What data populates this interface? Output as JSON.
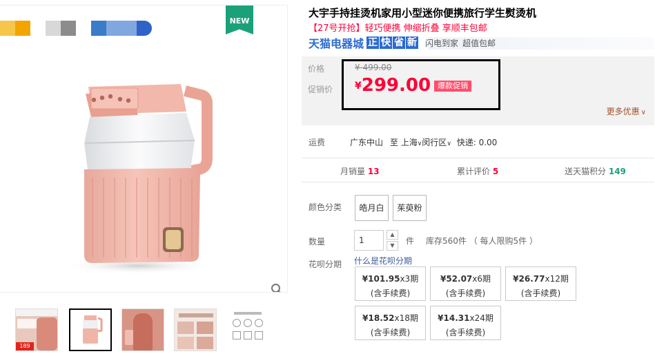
{
  "gallery": {
    "badge": "NEW",
    "thumbnail_count": 5,
    "thumb_texts": {
      "t1_price": "189"
    }
  },
  "product": {
    "title": "大宇手持挂烫机家用小型迷你便携旅行学生熨烫机",
    "subtitle": "【27号开抢】轻巧便携 伸缩折叠 享顺丰包邮",
    "store_badge": "天猫电器城",
    "tags": [
      "正",
      "快",
      "省",
      "新"
    ],
    "tag_extra": [
      "闪电到家",
      "超值包邮"
    ]
  },
  "price": {
    "original_label": "价格",
    "original": "¥ 499.00",
    "promo_label": "促销价",
    "currency": "¥",
    "current": "299.00",
    "promo_tag": "爆款促销",
    "more_deals": "更多优惠"
  },
  "shipping": {
    "label": "运费",
    "from": "广东中山",
    "to_prefix": "至",
    "to_city": "上海",
    "to_district": "闵行区",
    "fee": "快递: 0.00"
  },
  "stats": {
    "monthly_sales_label": "月销量",
    "monthly_sales": "13",
    "reviews_label": "累计评价",
    "reviews": "5",
    "points_label": "送天猫积分",
    "points": "149"
  },
  "options": {
    "color_label": "颜色分类",
    "colors": [
      "皓月白",
      "茱萸粉"
    ],
    "qty_label": "数量",
    "qty_value": "1",
    "qty_unit": "件",
    "stock_text": "库存560件 （ 每人限购5件 ）"
  },
  "installments": {
    "label": "花呗分期",
    "link": "什么是花呗分期",
    "plans": [
      {
        "price": "¥101.95",
        "period": "x3期",
        "note": "(含手续费)"
      },
      {
        "price": "¥52.07",
        "period": "x6期",
        "note": "(含手续费)"
      },
      {
        "price": "¥26.77",
        "period": "x12期",
        "note": "(含手续费)"
      },
      {
        "price": "¥18.52",
        "period": "x18期",
        "note": "(含手续费)"
      },
      {
        "price": "¥14.31",
        "period": "x24期",
        "note": "(含手续费)"
      }
    ]
  },
  "colors": {
    "price_red": "#ff0036",
    "tmall_blue": "#2b6ad1",
    "badge_green": "#1aa17a"
  }
}
